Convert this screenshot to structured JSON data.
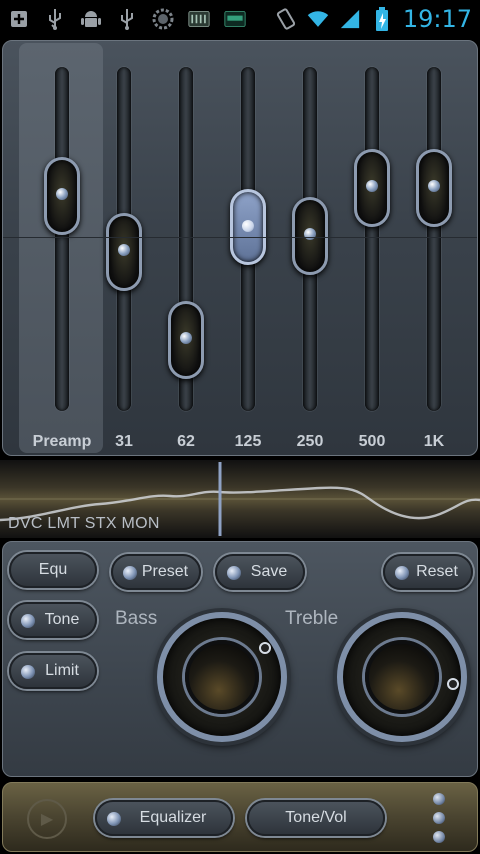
{
  "status_bar": {
    "left_icons": [
      "add-box-icon",
      "usb-icon",
      "android-debug-icon",
      "usb-icon",
      "settings-cog-icon",
      "equalizer-widget-icon",
      "digital-clock-widget-icon"
    ],
    "right_icons": [
      "rotate-icon",
      "wifi-icon",
      "signal-icon",
      "battery-charging-icon"
    ],
    "time": "19:17",
    "accent_color": "#33b5e5"
  },
  "equalizer": {
    "bands": [
      {
        "label": "Preamp",
        "level": 0.34
      },
      {
        "label": "31",
        "level": 0.55
      },
      {
        "label": "62",
        "level": 0.88
      },
      {
        "label": "125",
        "level": 0.46,
        "active": true
      },
      {
        "label": "250",
        "level": 0.49
      },
      {
        "label": "500",
        "level": 0.31
      },
      {
        "label": "1K",
        "level": 0.31
      }
    ]
  },
  "response_graph": {
    "status_text": "DVC LMT STX MON"
  },
  "controls": {
    "equ_label": "Equ",
    "preset_label": "Preset",
    "save_label": "Save",
    "reset_label": "Reset",
    "tone_label": "Tone",
    "limit_label": "Limit",
    "bass_label": "Bass",
    "treble_label": "Treble"
  },
  "bottom_bar": {
    "equalizer_tab": "Equalizer",
    "tone_vol_tab": "Tone/Vol",
    "play_icon": "play-icon",
    "menu_icon": "overflow-dots-icon"
  }
}
